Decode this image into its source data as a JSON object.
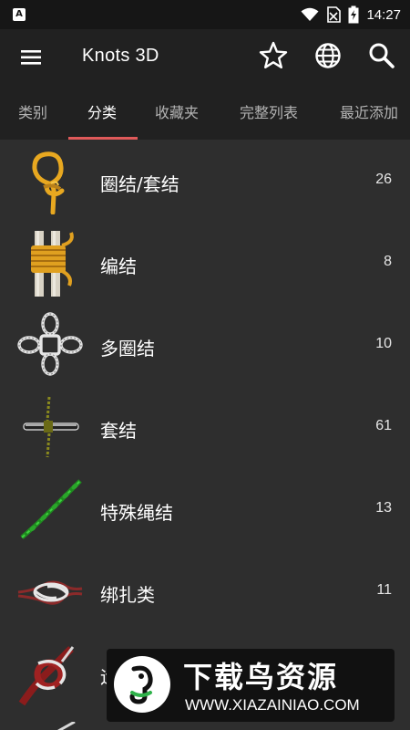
{
  "status_bar": {
    "app_icon_letter": "A",
    "time": "14:27"
  },
  "app_bar": {
    "title": "Knots 3D",
    "icons": [
      "menu-icon",
      "star-icon",
      "globe-icon",
      "search-icon"
    ]
  },
  "tabs": [
    {
      "label": "类别"
    },
    {
      "label": "分类",
      "active": true
    },
    {
      "label": "收藏夹"
    },
    {
      "label": "完整列表"
    },
    {
      "label": "最近添加"
    }
  ],
  "categories": [
    {
      "label": "圈结/套结",
      "count": "26"
    },
    {
      "label": "编结",
      "count": "8"
    },
    {
      "label": "多圈结",
      "count": "10"
    },
    {
      "label": "套结",
      "count": "61"
    },
    {
      "label": "特殊绳结",
      "count": "13"
    },
    {
      "label": "绑扎类",
      "count": "11"
    },
    {
      "label": "运"
    }
  ],
  "watermark": {
    "title": "下载鸟资源",
    "url": "WWW.XIAZAINIAO.COM"
  },
  "colors": {
    "background": "#2e2e2e",
    "app_bar": "#212121",
    "tab_indicator": "#e05a5a"
  }
}
